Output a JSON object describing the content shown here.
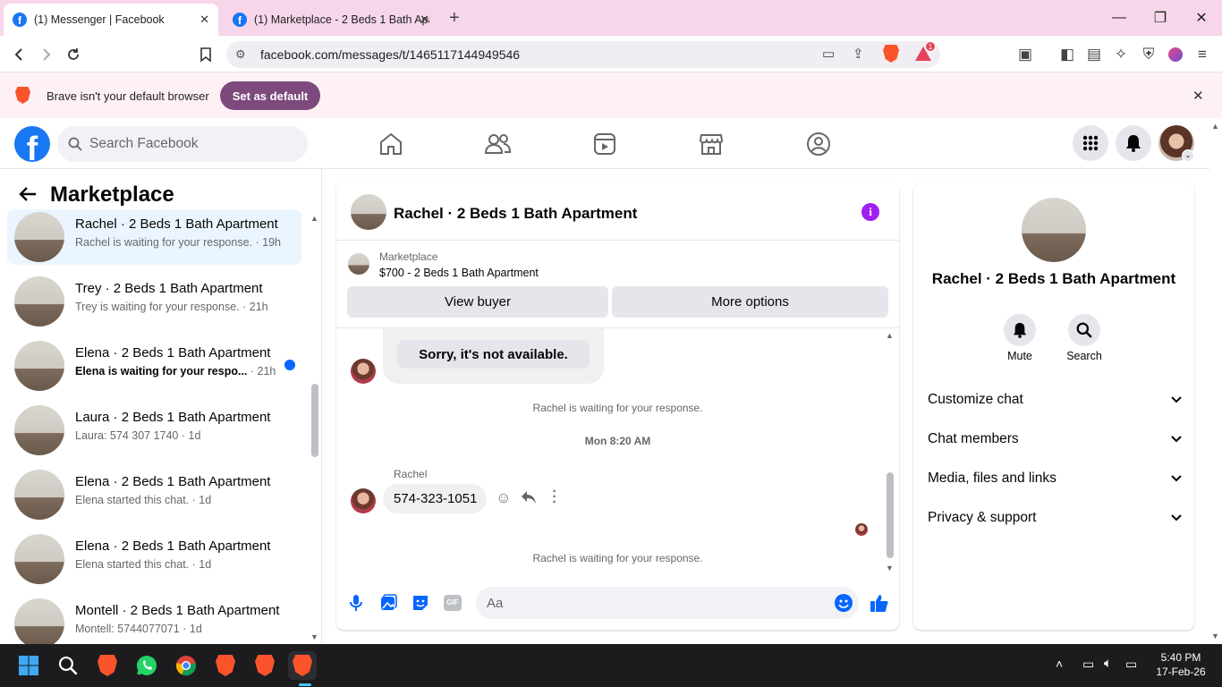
{
  "browser": {
    "tabs": [
      {
        "title": "(1) Messenger | Facebook",
        "active": true
      },
      {
        "title": "(1) Marketplace - 2 Beds 1 Bath Apart",
        "active": false
      }
    ],
    "url": "facebook.com/messages/t/1465117144949546",
    "notif_count": "1",
    "infobar_text": "Brave isn't your default browser",
    "set_default_label": "Set as default",
    "accent": "#7d4a7d"
  },
  "facebook": {
    "logo": "f",
    "search_placeholder": "Search Facebook",
    "brand_color": "#1877f2"
  },
  "left_panel": {
    "title": "Marketplace",
    "conversations": [
      {
        "title": "Rachel · 2 Beds 1 Bath Apartment",
        "snippet": "Rachel is waiting for your response.",
        "time": "· 19h",
        "selected": true,
        "unread": false
      },
      {
        "title": "Trey · 2 Beds 1 Bath Apartment",
        "snippet": "Trey is waiting for your response.",
        "time": "· 21h",
        "selected": false,
        "unread": false
      },
      {
        "title": "Elena · 2 Beds 1 Bath Apartment",
        "snippet": "Elena is waiting for your respo...",
        "time": "· 21h",
        "selected": false,
        "unread": true
      },
      {
        "title": "Laura · 2 Beds 1 Bath Apartment",
        "snippet": "Laura: 574 307 1740",
        "time": "· 1d",
        "selected": false,
        "unread": false
      },
      {
        "title": "Elena · 2 Beds 1 Bath Apartment",
        "snippet": "Elena started this chat.",
        "time": "· 1d",
        "selected": false,
        "unread": false
      },
      {
        "title": "Elena · 2 Beds 1 Bath Apartment",
        "snippet": "Elena started this chat.",
        "time": "· 1d",
        "selected": false,
        "unread": false
      },
      {
        "title": "Montell · 2 Beds 1 Bath Apartment",
        "snippet": "Montell: 5744077071",
        "time": "· 1d",
        "selected": false,
        "unread": false
      }
    ]
  },
  "chat": {
    "title": "Rachel · 2 Beds 1 Bath Apartment",
    "listing_label": "Marketplace",
    "listing_detail": "$700 - 2 Beds 1 Bath Apartment",
    "view_buyer": "View buyer",
    "more_options": "More options",
    "quick_reply": "Sorry, it's not available.",
    "system_msg_1": "Rachel is waiting for your response.",
    "timestamp": "Mon 8:20 AM",
    "sender": "Rachel",
    "phone_msg": "574-323-1051",
    "system_msg_2": "Rachel is waiting for your response.",
    "composer_placeholder": "Aa"
  },
  "info_panel": {
    "name": "Rachel · 2 Beds 1 Bath Apartment",
    "mute": "Mute",
    "search": "Search",
    "sections": [
      "Customize chat",
      "Chat members",
      "Media, files and links",
      "Privacy & support"
    ]
  },
  "taskbar": {
    "time": "5:40 PM",
    "date": "17-Feb-26"
  }
}
